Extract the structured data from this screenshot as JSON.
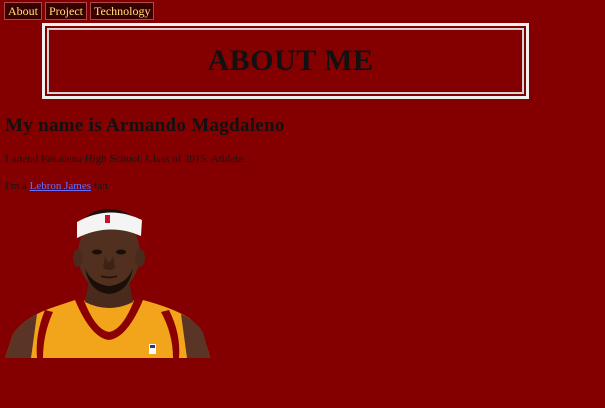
{
  "nav": {
    "items": [
      "About",
      "Project",
      "Technology"
    ]
  },
  "banner": {
    "title": "ABOUT ME"
  },
  "profile": {
    "heading": "My name is Armando Magdaleno",
    "intro": "I attend Pasadena High School, Class of 2015. Athlete.",
    "prefix": "I'm a ",
    "link_text": "Lebron James",
    "suffix": " fan"
  },
  "image": {
    "icon": "person-portrait-icon"
  },
  "colors": {
    "page_background": "#840000",
    "nav_background": "#3a0000",
    "nav_text": "#ffe27a",
    "link": "#5f6eff",
    "jersey": "#f2a51a",
    "jersey_trim": "#8b0000"
  }
}
